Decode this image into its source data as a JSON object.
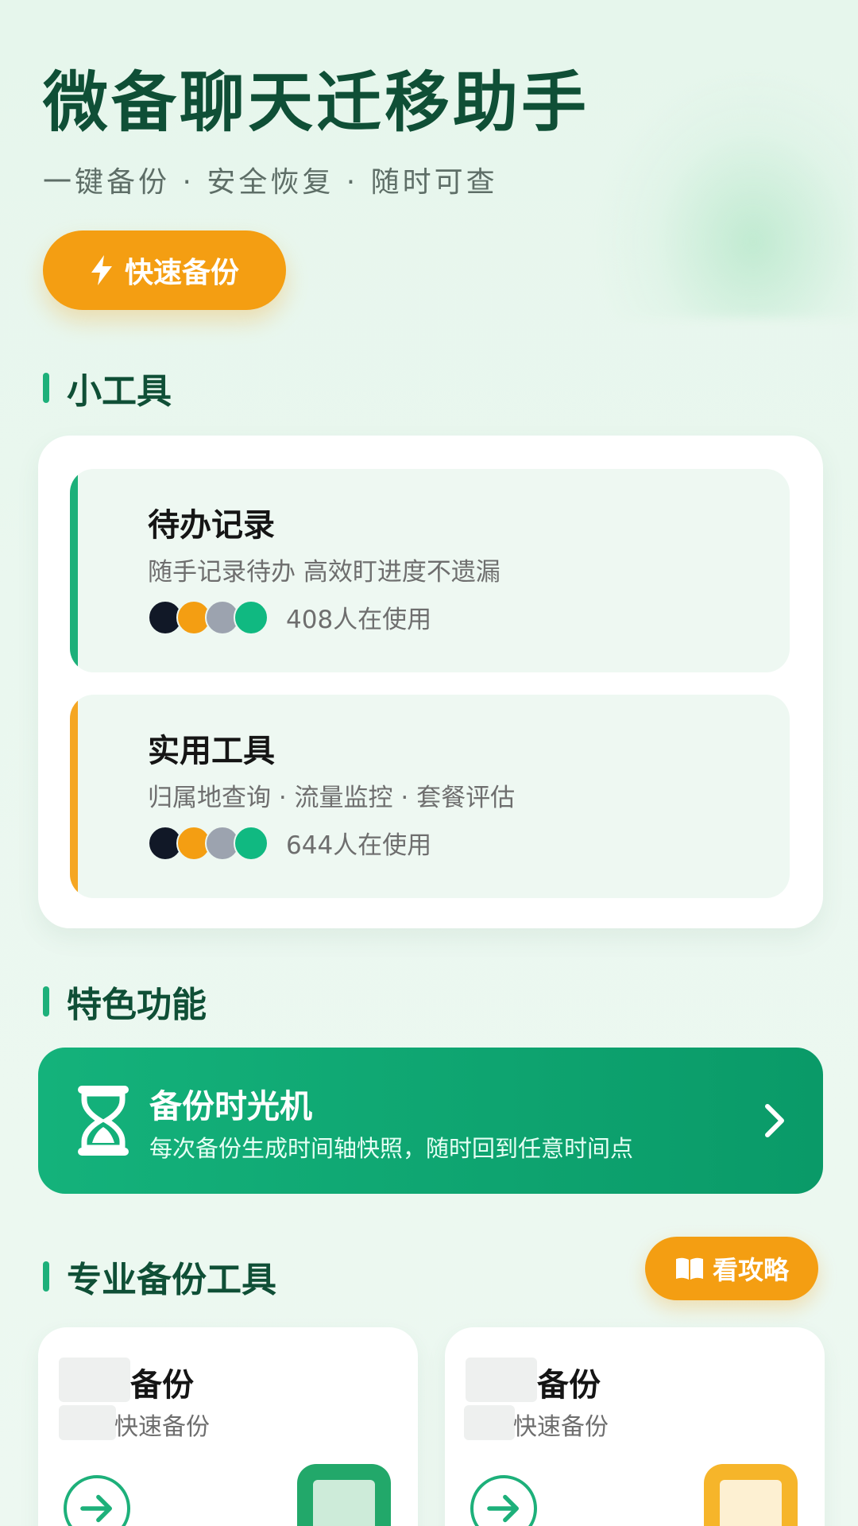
{
  "header": {
    "title": "微备聊天迁移助手",
    "subtitle": "一键备份 · 安全恢复 · 随时可查",
    "quick_backup_label": "快速备份",
    "quick_backup_icon": "lightning-icon"
  },
  "sections": {
    "tools_title": "小工具",
    "features_title": "特色功能",
    "pro_title": "专业备份工具"
  },
  "tools": [
    {
      "name": "待办记录",
      "desc": "随手记录待办 高效盯进度不遗漏",
      "users": "408人在使用",
      "accent": "#1db07a"
    },
    {
      "name": "实用工具",
      "desc": "归属地查询 · 流量监控 · 套餐评估",
      "users": "644人在使用",
      "accent": "#f5a623"
    }
  ],
  "avatar_colors": [
    "#111827",
    "#f49e12",
    "#9ca3af",
    "#10b981"
  ],
  "feature": {
    "title": "备份时光机",
    "desc": "每次备份生成时间轴快照，随时回到任意时间点",
    "icon": "hourglass-icon"
  },
  "guide_label": "看攻略",
  "guide_icon": "book-icon",
  "pro_tools": [
    {
      "name": "备份",
      "sub": "快速备份",
      "thumb_color": "#22a86a",
      "thumb_inner": "#cdebd9"
    },
    {
      "name": "备份",
      "sub": "快速备份",
      "thumb_color": "#f6b52a",
      "thumb_inner": "#fdf0d2"
    }
  ],
  "colors": {
    "brand_green": "#0f4f36",
    "accent_green": "#1db07a",
    "accent_orange": "#f49e12"
  }
}
